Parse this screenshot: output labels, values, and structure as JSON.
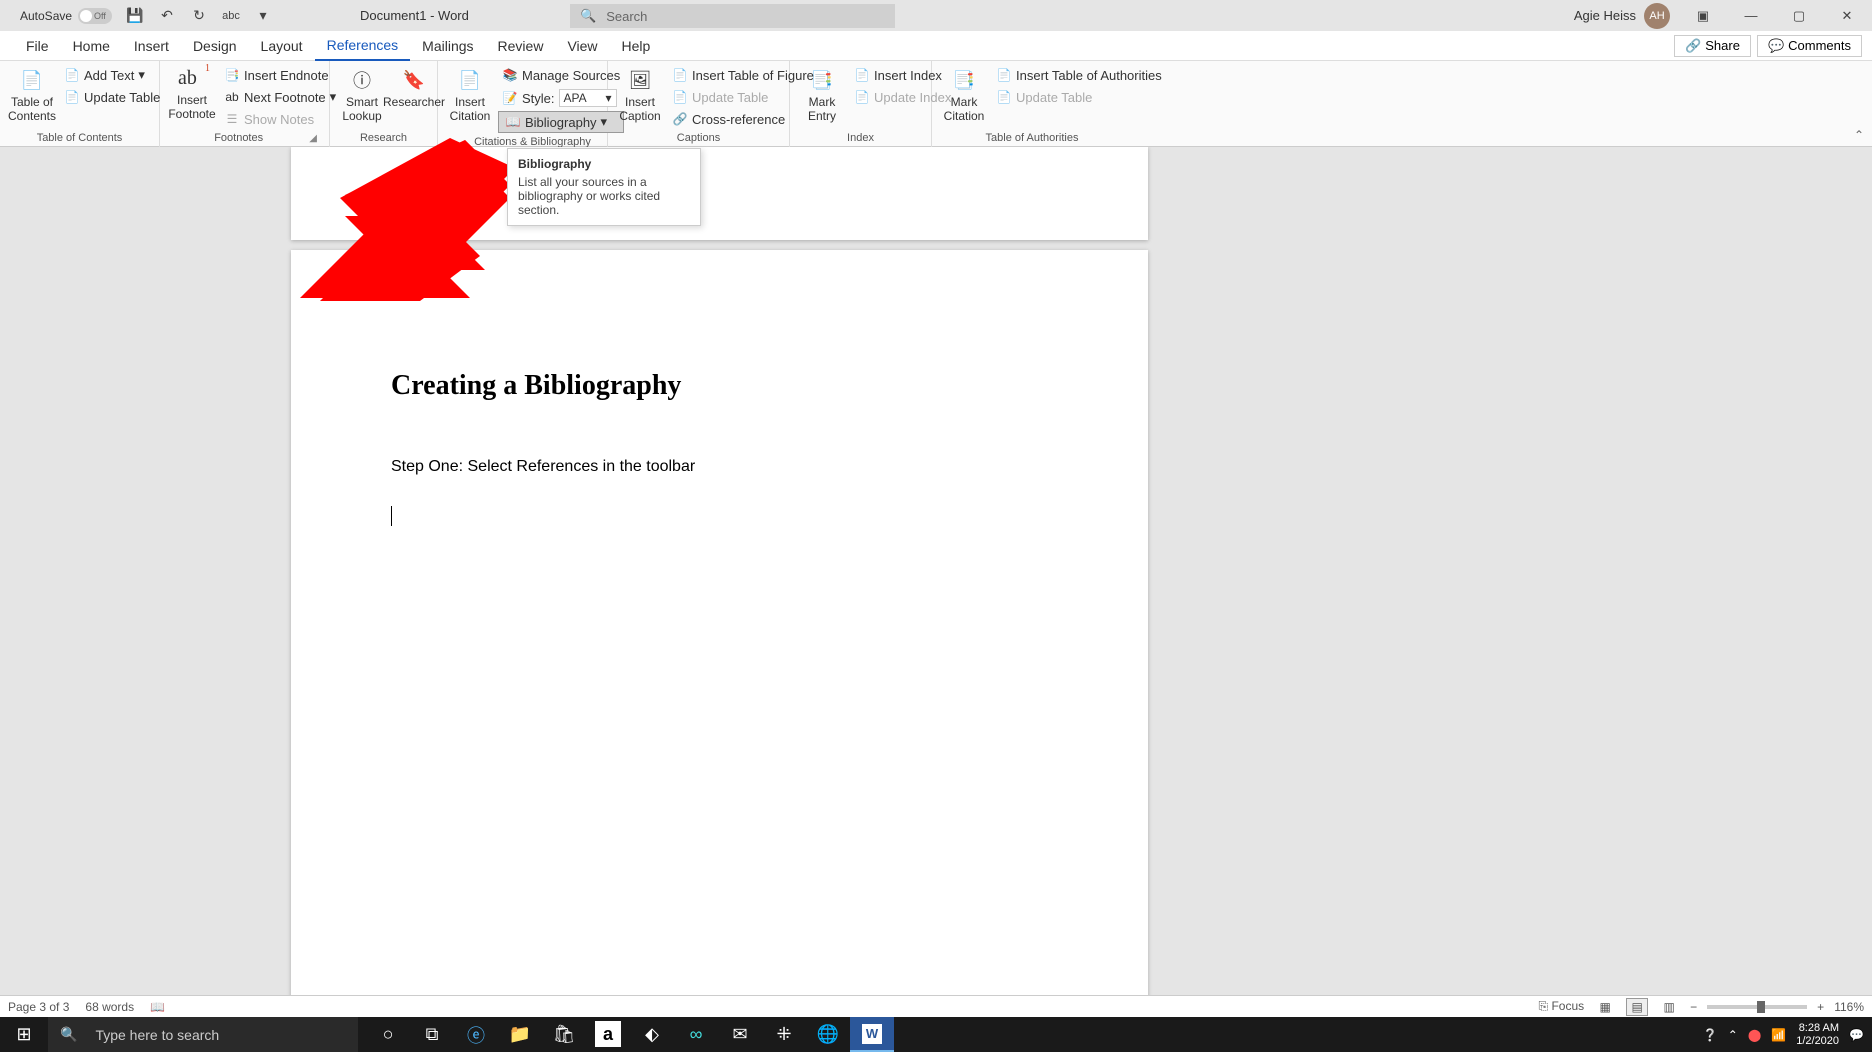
{
  "title_bar": {
    "autosave_label": "AutoSave",
    "autosave_state": "Off",
    "doc_title": "Document1  -  Word",
    "search_placeholder": "Search",
    "user_name": "Agie Heiss",
    "user_initials": "AH"
  },
  "menu": {
    "file": "File",
    "home": "Home",
    "insert": "Insert",
    "design": "Design",
    "layout": "Layout",
    "references": "References",
    "mailings": "Mailings",
    "review": "Review",
    "view": "View",
    "help": "Help",
    "share": "Share",
    "comments": "Comments"
  },
  "ribbon": {
    "toc": {
      "big": "Table of\nContents",
      "add_text": "Add Text",
      "update": "Update Table",
      "group": "Table of Contents"
    },
    "footnotes": {
      "big": "Insert\nFootnote",
      "endnote": "Insert Endnote",
      "next": "Next Footnote",
      "show": "Show Notes",
      "group": "Footnotes",
      "ab": "ab"
    },
    "research": {
      "smart": "Smart\nLookup",
      "researcher": "Researcher",
      "group": "Research"
    },
    "citations": {
      "insert": "Insert\nCitation",
      "manage": "Manage Sources",
      "style_label": "Style:",
      "style_value": "APA",
      "biblio": "Bibliography",
      "group": "Citations & Bibliography"
    },
    "captions": {
      "insert": "Insert\nCaption",
      "table_figs": "Insert Table of Figures",
      "update": "Update Table",
      "cross_ref": "Cross-reference",
      "group": "Captions"
    },
    "index": {
      "mark": "Mark\nEntry",
      "insert": "Insert Index",
      "update": "Update Index",
      "group": "Index"
    },
    "authorities": {
      "mark": "Mark\nCitation",
      "insert": "Insert Table of Authorities",
      "update": "Update Table",
      "group": "Table of Authorities"
    }
  },
  "tooltip": {
    "title": "Bibliography",
    "body": "List all your sources in a bibliography or works cited section."
  },
  "document": {
    "heading": "Creating a Bibliography",
    "body": "Step One: Select References in the toolbar"
  },
  "status": {
    "page": "Page 3 of 3",
    "words": "68 words",
    "focus": "Focus",
    "zoom": "116%"
  },
  "taskbar": {
    "search": "Type here to search",
    "time": "8:28 AM",
    "date": "1/2/2020"
  }
}
